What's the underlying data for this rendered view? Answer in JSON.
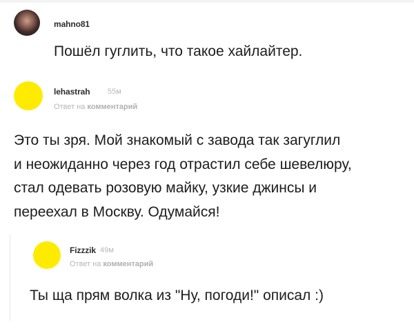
{
  "comments": [
    {
      "username": "mahno81",
      "text": "Пошёл гуглить, что такое хайлайтер."
    },
    {
      "username": "lehastrah",
      "time": "55м",
      "reply_prefix": "Ответ на",
      "reply_target": "комментарий",
      "lines": [
        "Это ты зря. Мой знакомый с завода так загуглил",
        "и неожиданно через год отрастил себе шевелюру,",
        "стал одевать розовую майку, узкие джинсы и",
        "переехал в Москву. Одумайся!"
      ]
    },
    {
      "username": "Fizzzik",
      "time": "49м",
      "reply_prefix": "Ответ на",
      "reply_target": "комментарий",
      "text": "Ты ща прям волка из \"Ну, погоди!\" описал :)"
    }
  ],
  "colors": {
    "avatar_yellow": "#ffeb00",
    "muted_text": "#b5b5b5"
  }
}
